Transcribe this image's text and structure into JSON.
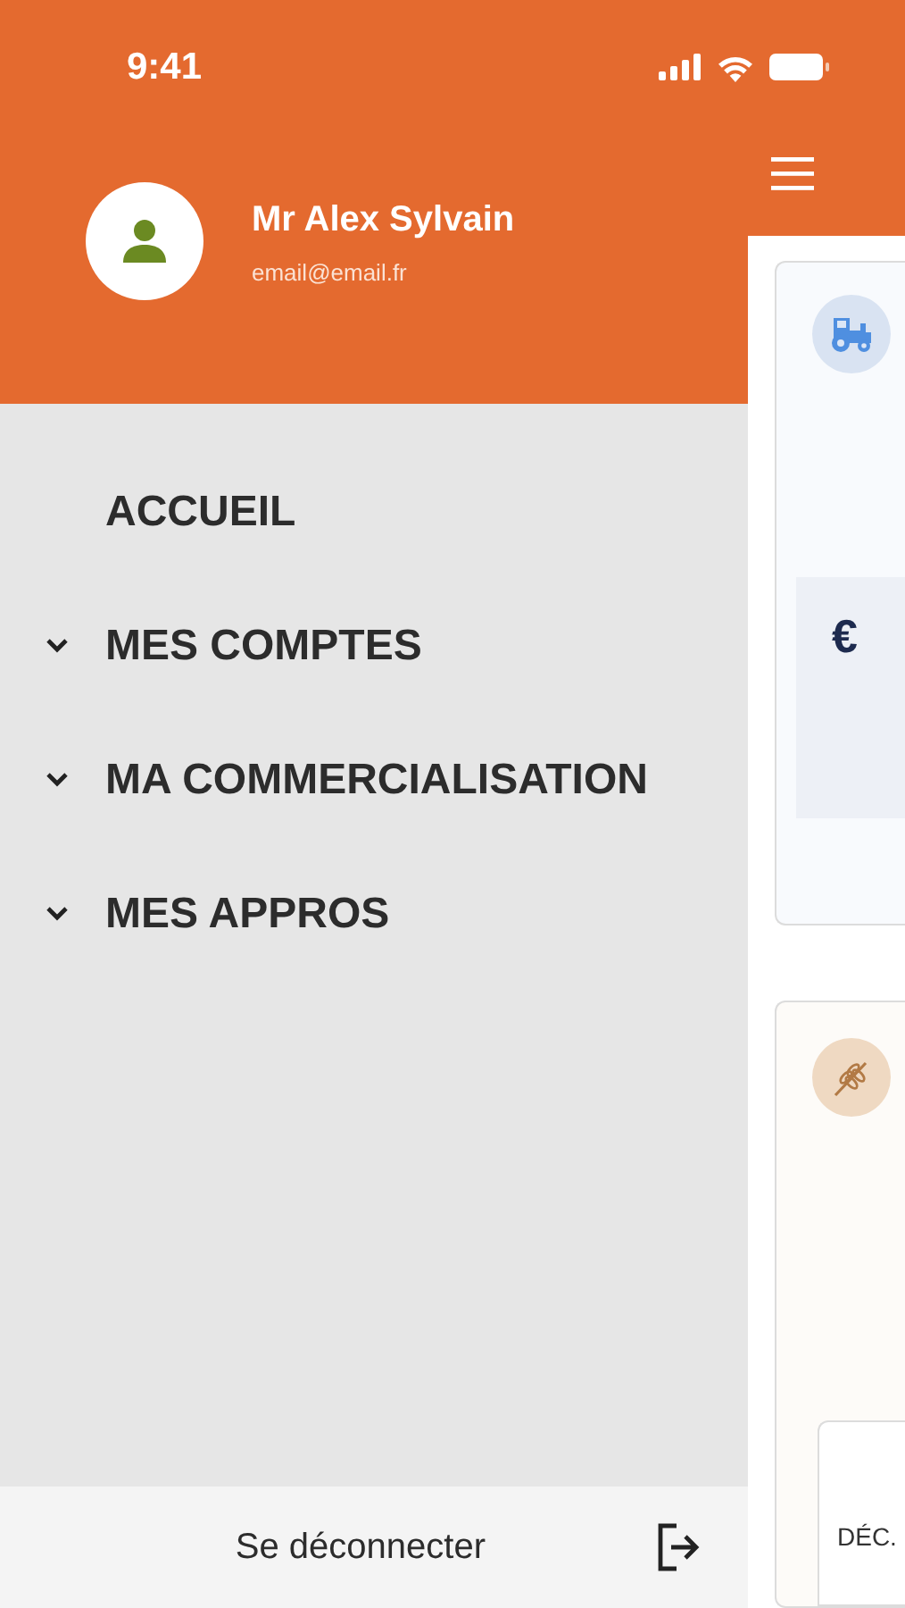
{
  "status_bar": {
    "time": "9:41"
  },
  "drawer": {
    "user": {
      "name": "Mr Alex Sylvain",
      "email": "email@email.fr"
    },
    "menu": [
      {
        "label": "ACCUEIL",
        "kind": "link"
      },
      {
        "label": "MES COMPTES",
        "kind": "group",
        "expanded": false
      },
      {
        "label": "MA COMMERCIALISATION",
        "kind": "group",
        "expanded": false
      },
      {
        "label": "MES APPROS",
        "kind": "group",
        "expanded": false
      }
    ],
    "logout": {
      "label": "Se déconnecter"
    }
  },
  "background": {
    "cards": [
      {
        "kind": "equipment",
        "amount_symbol": "€"
      },
      {
        "kind": "harvest",
        "month": "DÉC."
      }
    ]
  }
}
